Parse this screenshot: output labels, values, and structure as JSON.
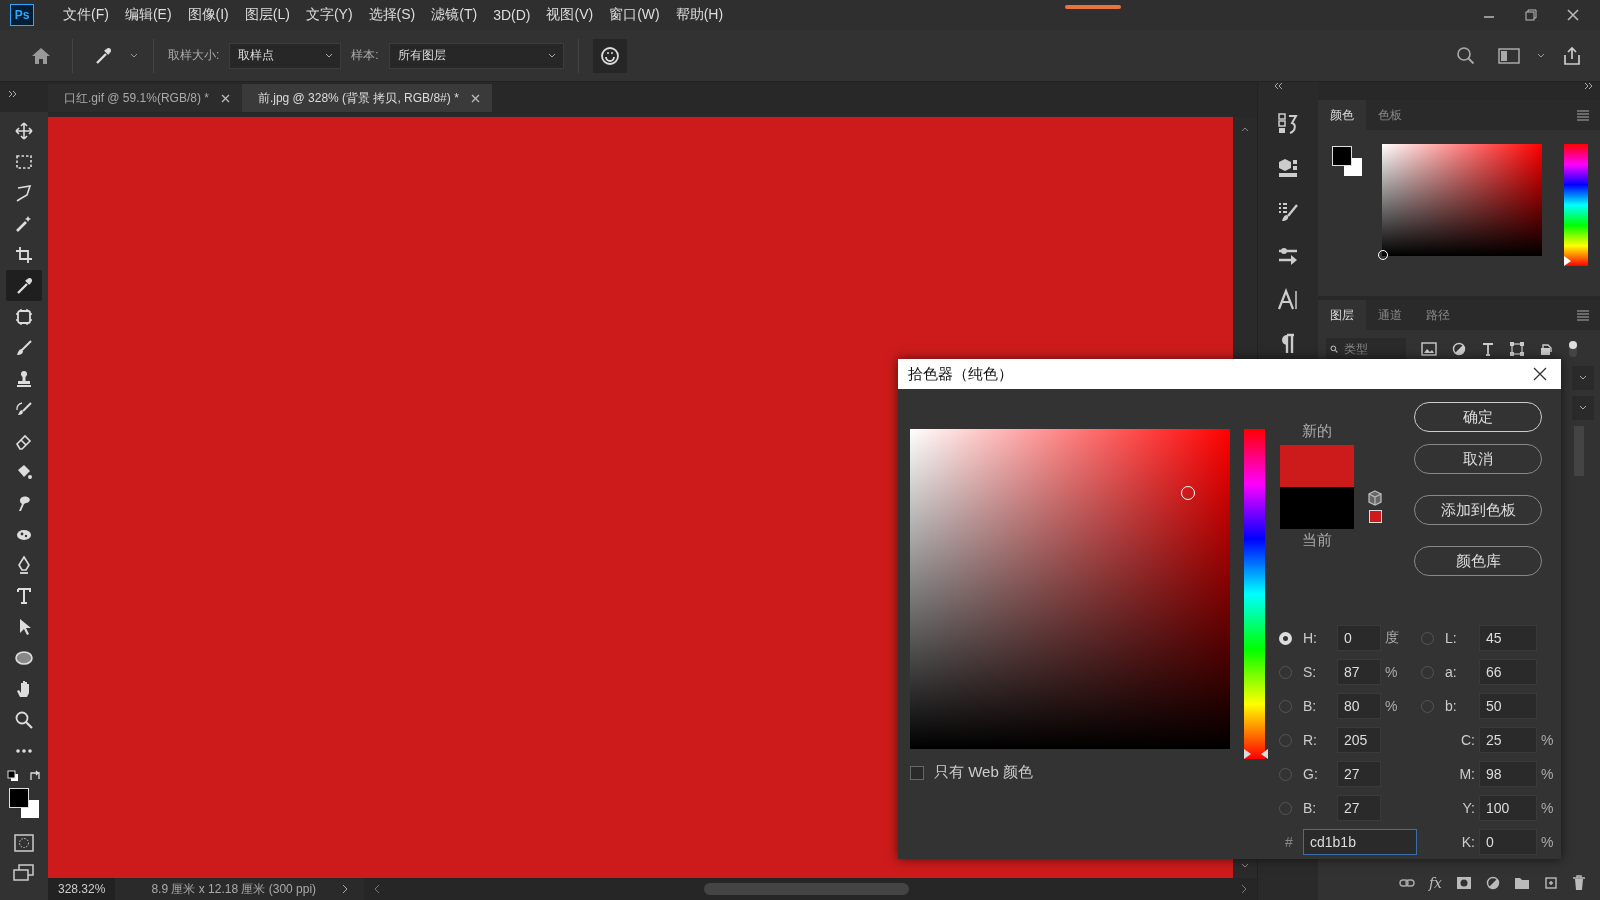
{
  "menu": {
    "logo": "Ps",
    "items": [
      "文件(F)",
      "编辑(E)",
      "图像(I)",
      "图层(L)",
      "文字(Y)",
      "选择(S)",
      "滤镜(T)",
      "3D(D)",
      "视图(V)",
      "窗口(W)",
      "帮助(H)"
    ]
  },
  "options_bar": {
    "sample_size_label": "取样大小:",
    "sample_size_value": "取样点",
    "sample_label": "样本:",
    "sample_value": "所有图层"
  },
  "document_tabs": [
    {
      "title": "口红.gif @ 59.1%(RGB/8) *",
      "selected": false
    },
    {
      "title": "前.jpg @ 328% (背景 拷贝, RGB/8#) *",
      "selected": true
    }
  ],
  "tools": [
    {
      "kind": "move",
      "selected": false
    },
    {
      "kind": "marquee",
      "selected": false
    },
    {
      "kind": "lasso",
      "selected": false
    },
    {
      "kind": "wand",
      "selected": false
    },
    {
      "kind": "crop",
      "selected": false
    },
    {
      "kind": "eyedropper",
      "selected": true
    },
    {
      "kind": "patch",
      "selected": false
    },
    {
      "kind": "brush",
      "selected": false
    },
    {
      "kind": "stamp",
      "selected": false
    },
    {
      "kind": "history",
      "selected": false
    },
    {
      "kind": "eraser",
      "selected": false
    },
    {
      "kind": "bucket",
      "selected": false
    },
    {
      "kind": "smudge",
      "selected": false
    },
    {
      "kind": "sponge",
      "selected": false
    },
    {
      "kind": "pen",
      "selected": false
    },
    {
      "kind": "type",
      "selected": false
    },
    {
      "kind": "select",
      "selected": false
    },
    {
      "kind": "ellipse",
      "selected": false
    },
    {
      "kind": "hand",
      "selected": false
    },
    {
      "kind": "zoom",
      "selected": false
    },
    {
      "kind": "more",
      "selected": false
    }
  ],
  "status_bar": {
    "zoom": "328.32%",
    "doc_info": "8.9 厘米 x 12.18 厘米 (300 ppi)"
  },
  "color_panel": {
    "tabs": [
      {
        "label": "颜色",
        "selected": true
      },
      {
        "label": "色板",
        "selected": false
      }
    ],
    "hue_slider": {
      "level": 0
    }
  },
  "layers_panel": {
    "tabs": [
      {
        "label": "图层",
        "selected": true
      },
      {
        "label": "通道",
        "selected": false
      },
      {
        "label": "路径",
        "selected": false
      }
    ],
    "search": {
      "placeholder": "类型"
    },
    "fx": "fx"
  },
  "color_picker": {
    "title": "拾色器（纯色）",
    "hue_slider": {
      "level": 0
    },
    "new_label": "新的",
    "current_label": "当前",
    "buttons": [
      "确定",
      "取消",
      "添加到色板",
      "颜色库"
    ],
    "web_only": {
      "label": "只有 Web 颜色",
      "checked": false
    },
    "left_fields": [
      {
        "label": "H:",
        "value": "0",
        "unit": "度",
        "selected": true
      },
      {
        "label": "S:",
        "value": "87",
        "unit": "%",
        "selected": false
      },
      {
        "label": "B:",
        "value": "80",
        "unit": "%",
        "selected": false
      },
      {
        "label": "R:",
        "value": "205",
        "selected": false
      },
      {
        "label": "G:",
        "value": "27",
        "selected": false
      },
      {
        "label": "B:",
        "value": "27",
        "selected": false
      }
    ],
    "lab_fields": [
      {
        "label": "L:",
        "value": "45",
        "selected": false
      },
      {
        "label": "a:",
        "value": "66",
        "selected": false
      },
      {
        "label": "b:",
        "value": "50",
        "selected": false
      }
    ],
    "cmyk_fields": [
      {
        "label": "C:",
        "value": "25",
        "unit": "%"
      },
      {
        "label": "M:",
        "value": "98",
        "unit": "%"
      },
      {
        "label": "Y:",
        "value": "100",
        "unit": "%"
      },
      {
        "label": "K:",
        "value": "0",
        "unit": "%"
      }
    ],
    "hex": {
      "label": "#",
      "value": "cd1b1b"
    }
  }
}
